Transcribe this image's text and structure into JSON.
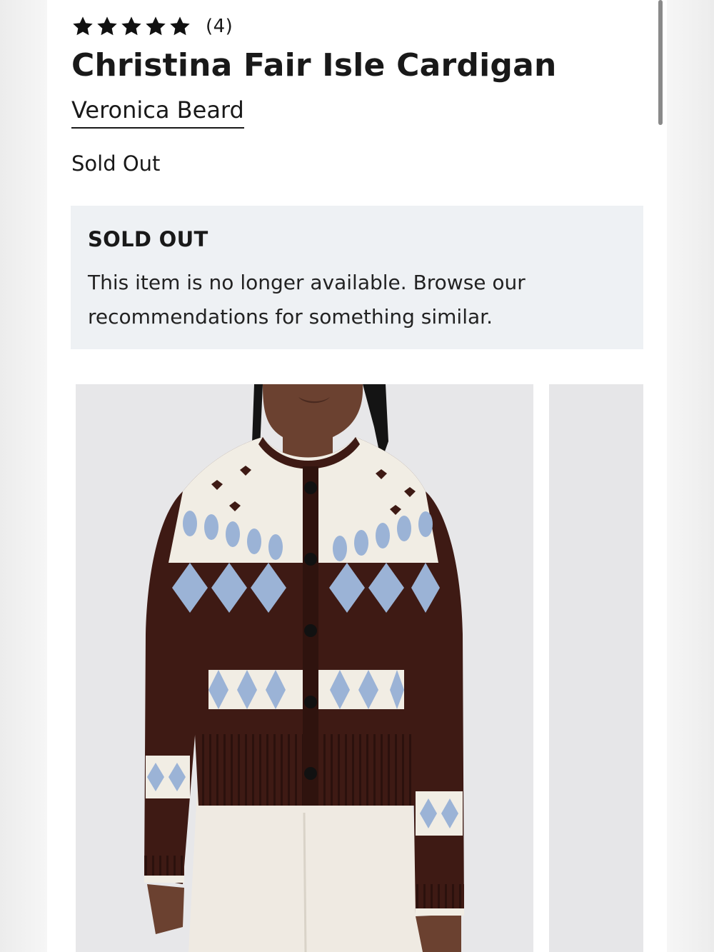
{
  "product": {
    "rating": {
      "stars": 5,
      "count_text": "(4)"
    },
    "title": "Christina Fair Isle Cardigan",
    "brand": "Veronica Beard",
    "status": "Sold Out"
  },
  "notice": {
    "title": "SOLD OUT",
    "message": "This item is no longer available. Browse our recommendations for something similar."
  },
  "gallery": {
    "images": [
      {
        "icon": "product-photo-cardigan-front"
      },
      {
        "icon": "product-photo-next-peek"
      }
    ]
  },
  "colors": {
    "accent_text": "#191919",
    "notice_bg": "#eef1f4",
    "sweater_brown": "#3e1a14",
    "sweater_cream": "#f1ede4",
    "sweater_blue": "#9bb3d6"
  }
}
